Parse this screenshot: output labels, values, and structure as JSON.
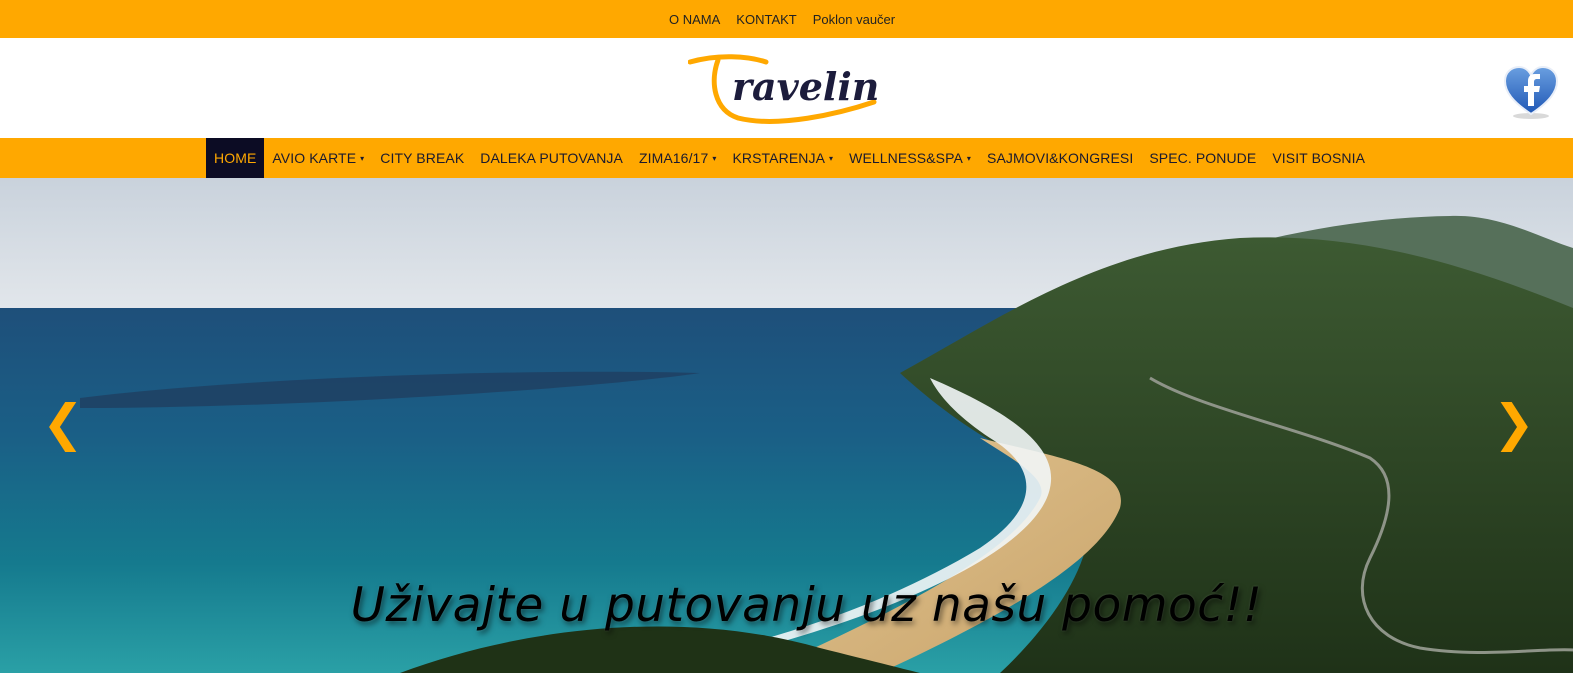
{
  "top_menu": {
    "items": [
      "O NAMA",
      "KONTAKT",
      "Poklon vaučer"
    ]
  },
  "header": {
    "logo_text": "Travelin"
  },
  "nav": {
    "items": [
      {
        "label": "HOME",
        "active": true,
        "has_dropdown": false
      },
      {
        "label": "AVIO KARTE",
        "active": false,
        "has_dropdown": true
      },
      {
        "label": "CITY BREAK",
        "active": false,
        "has_dropdown": false
      },
      {
        "label": "DALEKA PUTOVANJA",
        "active": false,
        "has_dropdown": false
      },
      {
        "label": "ZIMA16/17",
        "active": false,
        "has_dropdown": true
      },
      {
        "label": "KRSTARENJA",
        "active": false,
        "has_dropdown": true
      },
      {
        "label": "WELLNESS&SPA",
        "active": false,
        "has_dropdown": true
      },
      {
        "label": "SAJMOVI&KONGRESI",
        "active": false,
        "has_dropdown": false
      },
      {
        "label": "SPEC. PONUDE",
        "active": false,
        "has_dropdown": false
      },
      {
        "label": "VISIT BOSNIA",
        "active": false,
        "has_dropdown": false
      }
    ],
    "caret": "▾"
  },
  "slider": {
    "prev_arrow": "❮",
    "next_arrow": "❯",
    "caption": "Uživajte u putovanju uz našu pomoć!!"
  },
  "colors": {
    "brand_orange": "#ffa800",
    "nav_active_bg": "#0c0c24",
    "logo_navy": "#1c1c3c"
  },
  "icons": [
    "facebook-heart-icon",
    "prev-arrow-icon",
    "next-arrow-icon",
    "caret-down-icon"
  ]
}
